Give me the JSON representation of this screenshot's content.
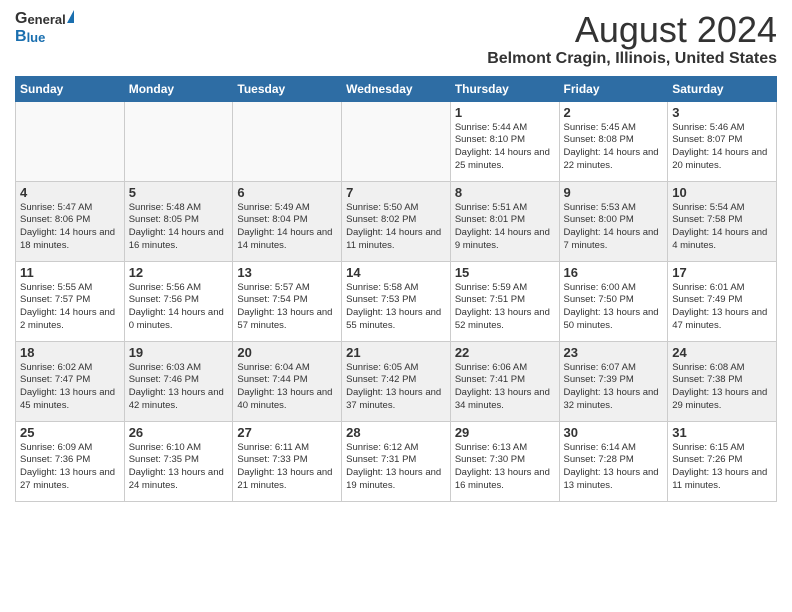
{
  "header": {
    "logo_general": "General",
    "logo_blue": "Blue",
    "month_title": "August 2024",
    "location": "Belmont Cragin, Illinois, United States"
  },
  "days_of_week": [
    "Sunday",
    "Monday",
    "Tuesday",
    "Wednesday",
    "Thursday",
    "Friday",
    "Saturday"
  ],
  "weeks": [
    [
      {
        "day": "",
        "info": ""
      },
      {
        "day": "",
        "info": ""
      },
      {
        "day": "",
        "info": ""
      },
      {
        "day": "",
        "info": ""
      },
      {
        "day": "1",
        "info": "Sunrise: 5:44 AM\nSunset: 8:10 PM\nDaylight: 14 hours\nand 25 minutes."
      },
      {
        "day": "2",
        "info": "Sunrise: 5:45 AM\nSunset: 8:08 PM\nDaylight: 14 hours\nand 22 minutes."
      },
      {
        "day": "3",
        "info": "Sunrise: 5:46 AM\nSunset: 8:07 PM\nDaylight: 14 hours\nand 20 minutes."
      }
    ],
    [
      {
        "day": "4",
        "info": "Sunrise: 5:47 AM\nSunset: 8:06 PM\nDaylight: 14 hours\nand 18 minutes."
      },
      {
        "day": "5",
        "info": "Sunrise: 5:48 AM\nSunset: 8:05 PM\nDaylight: 14 hours\nand 16 minutes."
      },
      {
        "day": "6",
        "info": "Sunrise: 5:49 AM\nSunset: 8:04 PM\nDaylight: 14 hours\nand 14 minutes."
      },
      {
        "day": "7",
        "info": "Sunrise: 5:50 AM\nSunset: 8:02 PM\nDaylight: 14 hours\nand 11 minutes."
      },
      {
        "day": "8",
        "info": "Sunrise: 5:51 AM\nSunset: 8:01 PM\nDaylight: 14 hours\nand 9 minutes."
      },
      {
        "day": "9",
        "info": "Sunrise: 5:53 AM\nSunset: 8:00 PM\nDaylight: 14 hours\nand 7 minutes."
      },
      {
        "day": "10",
        "info": "Sunrise: 5:54 AM\nSunset: 7:58 PM\nDaylight: 14 hours\nand 4 minutes."
      }
    ],
    [
      {
        "day": "11",
        "info": "Sunrise: 5:55 AM\nSunset: 7:57 PM\nDaylight: 14 hours\nand 2 minutes."
      },
      {
        "day": "12",
        "info": "Sunrise: 5:56 AM\nSunset: 7:56 PM\nDaylight: 14 hours\nand 0 minutes."
      },
      {
        "day": "13",
        "info": "Sunrise: 5:57 AM\nSunset: 7:54 PM\nDaylight: 13 hours\nand 57 minutes."
      },
      {
        "day": "14",
        "info": "Sunrise: 5:58 AM\nSunset: 7:53 PM\nDaylight: 13 hours\nand 55 minutes."
      },
      {
        "day": "15",
        "info": "Sunrise: 5:59 AM\nSunset: 7:51 PM\nDaylight: 13 hours\nand 52 minutes."
      },
      {
        "day": "16",
        "info": "Sunrise: 6:00 AM\nSunset: 7:50 PM\nDaylight: 13 hours\nand 50 minutes."
      },
      {
        "day": "17",
        "info": "Sunrise: 6:01 AM\nSunset: 7:49 PM\nDaylight: 13 hours\nand 47 minutes."
      }
    ],
    [
      {
        "day": "18",
        "info": "Sunrise: 6:02 AM\nSunset: 7:47 PM\nDaylight: 13 hours\nand 45 minutes."
      },
      {
        "day": "19",
        "info": "Sunrise: 6:03 AM\nSunset: 7:46 PM\nDaylight: 13 hours\nand 42 minutes."
      },
      {
        "day": "20",
        "info": "Sunrise: 6:04 AM\nSunset: 7:44 PM\nDaylight: 13 hours\nand 40 minutes."
      },
      {
        "day": "21",
        "info": "Sunrise: 6:05 AM\nSunset: 7:42 PM\nDaylight: 13 hours\nand 37 minutes."
      },
      {
        "day": "22",
        "info": "Sunrise: 6:06 AM\nSunset: 7:41 PM\nDaylight: 13 hours\nand 34 minutes."
      },
      {
        "day": "23",
        "info": "Sunrise: 6:07 AM\nSunset: 7:39 PM\nDaylight: 13 hours\nand 32 minutes."
      },
      {
        "day": "24",
        "info": "Sunrise: 6:08 AM\nSunset: 7:38 PM\nDaylight: 13 hours\nand 29 minutes."
      }
    ],
    [
      {
        "day": "25",
        "info": "Sunrise: 6:09 AM\nSunset: 7:36 PM\nDaylight: 13 hours\nand 27 minutes."
      },
      {
        "day": "26",
        "info": "Sunrise: 6:10 AM\nSunset: 7:35 PM\nDaylight: 13 hours\nand 24 minutes."
      },
      {
        "day": "27",
        "info": "Sunrise: 6:11 AM\nSunset: 7:33 PM\nDaylight: 13 hours\nand 21 minutes."
      },
      {
        "day": "28",
        "info": "Sunrise: 6:12 AM\nSunset: 7:31 PM\nDaylight: 13 hours\nand 19 minutes."
      },
      {
        "day": "29",
        "info": "Sunrise: 6:13 AM\nSunset: 7:30 PM\nDaylight: 13 hours\nand 16 minutes."
      },
      {
        "day": "30",
        "info": "Sunrise: 6:14 AM\nSunset: 7:28 PM\nDaylight: 13 hours\nand 13 minutes."
      },
      {
        "day": "31",
        "info": "Sunrise: 6:15 AM\nSunset: 7:26 PM\nDaylight: 13 hours\nand 11 minutes."
      }
    ]
  ]
}
